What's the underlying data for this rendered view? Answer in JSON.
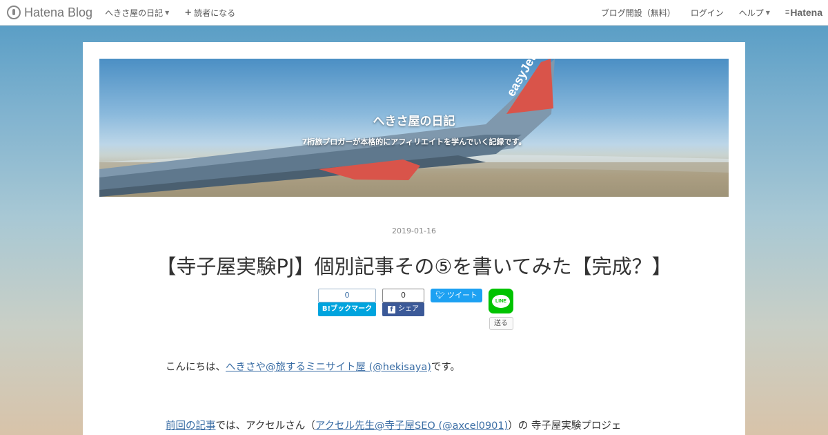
{
  "topbar": {
    "logo_text": "Hatena Blog",
    "blog_menu_label": "へきさ屋の日記",
    "subscribe_label": "読者になる",
    "start_blog_label": "ブログ開設（無料）",
    "login_label": "ログイン",
    "help_label": "ヘルプ",
    "hatena_label": "Hatena"
  },
  "header": {
    "blog_title": "へきさ屋の日記",
    "blog_description": "7桁旅ブロガーが本格的にアフィリエイトを学んでいく記録です。",
    "wing_text": "easyJet"
  },
  "entry": {
    "date": "2019-01-16",
    "title": "【寺子屋実験PJ】個別記事その⑤を書いてみた【完成？】"
  },
  "share": {
    "hatena_count": "0",
    "hatena_label": "B!ブックマーク",
    "facebook_count": "0",
    "facebook_label": "シェア",
    "twitter_label": "ツイート",
    "line_icon_text": "LINE",
    "line_send_label": "送る"
  },
  "body": {
    "p1_prefix": "こんにちは、",
    "p1_link": "へきさや@旅するミニサイト屋 (@hekisaya)",
    "p1_suffix": "です。",
    "p2_link1": "前回の記事",
    "p2_middle": "では、アクセルさん（",
    "p2_link2": "アクセル先生@寺子屋SEO (@axcel0901)",
    "p2_suffix": "）の 寺子屋実験プロジェ"
  },
  "colors": {
    "hatena_bookmark": "#00a4de",
    "facebook": "#3b5998",
    "twitter": "#1da1f2",
    "line": "#00c300",
    "link": "#3b6ea5"
  }
}
